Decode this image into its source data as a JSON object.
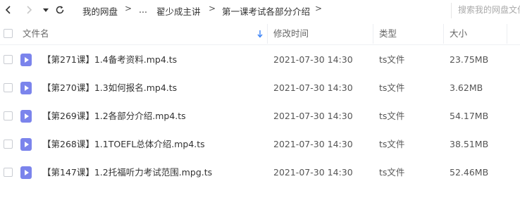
{
  "nav": {
    "breadcrumbs": [
      "我的网盘",
      "...",
      "翟少成主讲",
      "第一课考试各部分介绍"
    ],
    "separator": ">",
    "search_placeholder": "搜索我的网盘文件"
  },
  "columns": {
    "name": "文件名",
    "modified": "修改时间",
    "type": "类型",
    "size": "大小"
  },
  "files": [
    {
      "name": "【第271课】1.4备考资料.mp4.ts",
      "modified": "2021-07-30 14:30",
      "type": "ts文件",
      "size": "23.75MB"
    },
    {
      "name": "【第270课】1.3如何报名.mp4.ts",
      "modified": "2021-07-30 14:30",
      "type": "ts文件",
      "size": "3.62MB"
    },
    {
      "name": "【第269课】1.2各部分介绍.mp4.ts",
      "modified": "2021-07-30 14:30",
      "type": "ts文件",
      "size": "54.17MB"
    },
    {
      "name": "【第268课】1.1TOEFL总体介绍.mp4.ts",
      "modified": "2021-07-30 14:30",
      "type": "ts文件",
      "size": "38.51MB"
    },
    {
      "name": "【第147课】1.2托福听力考试范围.mpg.ts",
      "modified": "2021-07-30 14:30",
      "type": "ts文件",
      "size": "52.46MB"
    }
  ],
  "colors": {
    "file_icon": "#7b84ec",
    "sort_arrow": "#3b82f6"
  }
}
